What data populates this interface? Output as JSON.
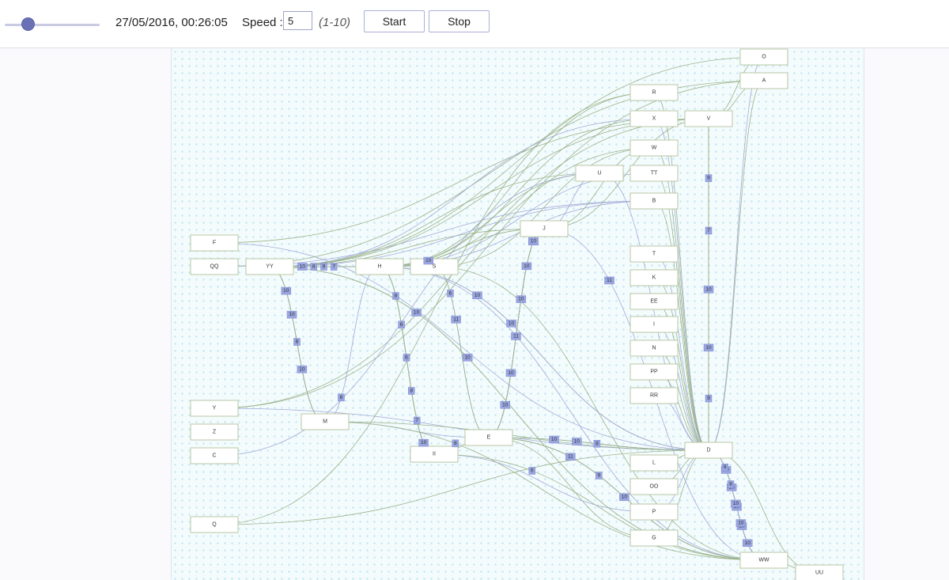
{
  "controls": {
    "timestamp": "27/05/2016, 00:26:05",
    "speed_label": "Speed :",
    "speed_value": "5",
    "speed_range": "(1-10)",
    "start_label": "Start",
    "stop_label": "Stop",
    "slider_level": 0.25
  },
  "colors": {
    "accent": "#6a72b5",
    "edge_green": "#9cb48a",
    "edge_blue": "#a3abd8",
    "edge_label_bg": "#9aa6e0",
    "node_border": "#b8c7a4"
  },
  "nodes": [
    {
      "id": "O",
      "label": "O"
    },
    {
      "id": "A",
      "label": "A"
    },
    {
      "id": "R",
      "label": "R"
    },
    {
      "id": "X",
      "label": "X"
    },
    {
      "id": "V",
      "label": "V"
    },
    {
      "id": "W",
      "label": "W"
    },
    {
      "id": "U",
      "label": "U"
    },
    {
      "id": "TT",
      "label": "TT"
    },
    {
      "id": "B",
      "label": "B"
    },
    {
      "id": "J",
      "label": "J"
    },
    {
      "id": "F",
      "label": "F"
    },
    {
      "id": "QQ",
      "label": "QQ"
    },
    {
      "id": "YY",
      "label": "YY"
    },
    {
      "id": "H",
      "label": "H"
    },
    {
      "id": "S",
      "label": "S"
    },
    {
      "id": "T",
      "label": "T"
    },
    {
      "id": "K",
      "label": "K"
    },
    {
      "id": "EE",
      "label": "EE"
    },
    {
      "id": "I",
      "label": "I"
    },
    {
      "id": "N",
      "label": "N"
    },
    {
      "id": "PP",
      "label": "PP"
    },
    {
      "id": "RR",
      "label": "RR"
    },
    {
      "id": "Y",
      "label": "Y"
    },
    {
      "id": "Z",
      "label": "Z"
    },
    {
      "id": "C",
      "label": "C"
    },
    {
      "id": "M",
      "label": "M"
    },
    {
      "id": "E",
      "label": "E"
    },
    {
      "id": "II",
      "label": "II"
    },
    {
      "id": "D",
      "label": "D"
    },
    {
      "id": "L",
      "label": "L"
    },
    {
      "id": "OO",
      "label": "OO"
    },
    {
      "id": "P",
      "label": "P"
    },
    {
      "id": "G",
      "label": "G"
    },
    {
      "id": "Q",
      "label": "Q"
    },
    {
      "id": "WW",
      "label": "WW"
    },
    {
      "id": "UU",
      "label": "UU"
    }
  ],
  "edges": [
    {
      "from": "YY",
      "to": "H",
      "label": "10"
    },
    {
      "from": "YY",
      "to": "H",
      "label": "8"
    },
    {
      "from": "YY",
      "to": "H",
      "label": "9"
    },
    {
      "from": "YY",
      "to": "H",
      "label": "7"
    },
    {
      "from": "H",
      "to": "J",
      "label": "10"
    },
    {
      "from": "M",
      "to": "H",
      "label": "6"
    },
    {
      "from": "YY",
      "to": "M",
      "label": "10"
    },
    {
      "from": "YY",
      "to": "M",
      "label": "10"
    },
    {
      "from": "YY",
      "to": "M",
      "label": "8"
    },
    {
      "from": "YY",
      "to": "M",
      "label": "10"
    },
    {
      "from": "YY",
      "to": "WW",
      "label": "10"
    },
    {
      "from": "H",
      "to": "II",
      "label": "8"
    },
    {
      "from": "H",
      "to": "II",
      "label": "6"
    },
    {
      "from": "H",
      "to": "II",
      "label": "6"
    },
    {
      "from": "H",
      "to": "II",
      "label": "8"
    },
    {
      "from": "H",
      "to": "II",
      "label": "7"
    },
    {
      "from": "H",
      "to": "II",
      "label": "10"
    },
    {
      "from": "S",
      "to": "E",
      "label": "6"
    },
    {
      "from": "S",
      "to": "E",
      "label": "11"
    },
    {
      "from": "E",
      "to": "J",
      "label": "10"
    },
    {
      "from": "E",
      "to": "J",
      "label": "10"
    },
    {
      "from": "E",
      "to": "J",
      "label": "11"
    },
    {
      "from": "E",
      "to": "J",
      "label": "10"
    },
    {
      "from": "E",
      "to": "J",
      "label": "10"
    },
    {
      "from": "E",
      "to": "J",
      "label": "10"
    },
    {
      "from": "E",
      "to": "J",
      "label": "10"
    },
    {
      "from": "E",
      "to": "J",
      "label": "9"
    },
    {
      "from": "E",
      "to": "J",
      "label": "10"
    },
    {
      "from": "E",
      "to": "D",
      "label": "10"
    },
    {
      "from": "E",
      "to": "D",
      "label": "10"
    },
    {
      "from": "E",
      "to": "D",
      "label": "8"
    },
    {
      "from": "E",
      "to": "WW",
      "label": "11"
    },
    {
      "from": "E",
      "to": "WW",
      "label": "9"
    },
    {
      "from": "E",
      "to": "WW",
      "label": "10"
    },
    {
      "from": "H",
      "to": "D",
      "label": "10"
    },
    {
      "from": "H",
      "to": "D",
      "label": "10"
    },
    {
      "from": "M",
      "to": "WW",
      "label": "8"
    },
    {
      "from": "II",
      "to": "WW",
      "label": "6"
    },
    {
      "from": "J",
      "to": "WW",
      "label": "11"
    },
    {
      "from": "YY",
      "to": "WW",
      "label": "10"
    },
    {
      "from": "WW",
      "to": "D",
      "label": "10"
    },
    {
      "from": "WW",
      "to": "D",
      "label": "10"
    },
    {
      "from": "WW",
      "to": "D",
      "label": "10"
    },
    {
      "from": "WW",
      "to": "D",
      "label": "10"
    },
    {
      "from": "WW",
      "to": "D",
      "label": "10"
    },
    {
      "from": "D",
      "to": "V",
      "label": "9"
    },
    {
      "from": "D",
      "to": "V",
      "label": "10"
    },
    {
      "from": "D",
      "to": "V",
      "label": "10"
    },
    {
      "from": "D",
      "to": "V",
      "label": "7"
    },
    {
      "from": "D",
      "to": "V",
      "label": "9"
    },
    {
      "from": "D",
      "to": "WW",
      "label": "6"
    },
    {
      "from": "D",
      "to": "WW",
      "label": "8"
    },
    {
      "from": "D",
      "to": "WW",
      "label": "10"
    },
    {
      "from": "D",
      "to": "WW",
      "label": "10"
    }
  ]
}
